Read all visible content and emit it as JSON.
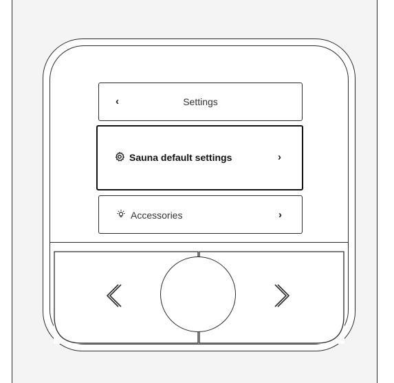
{
  "menu": {
    "header": {
      "back_icon": "chevron-left-icon",
      "back_glyph": "‹",
      "title": "Settings"
    },
    "selected_item": {
      "icon": "gear-icon",
      "label": "Sauna default settings",
      "chevron_glyph": "›"
    },
    "accessories_item": {
      "icon": "lightbulb-icon",
      "label": "Accessories",
      "chevron_glyph": "›"
    }
  },
  "controls": {
    "left_button_icon": "angle-left-icon",
    "center_knob": "rotary-knob",
    "right_button_icon": "angle-right-icon"
  },
  "colors": {
    "outline": "#2b2b2b",
    "background": "#ffffff",
    "frame_bg": "#f4f4f4"
  }
}
